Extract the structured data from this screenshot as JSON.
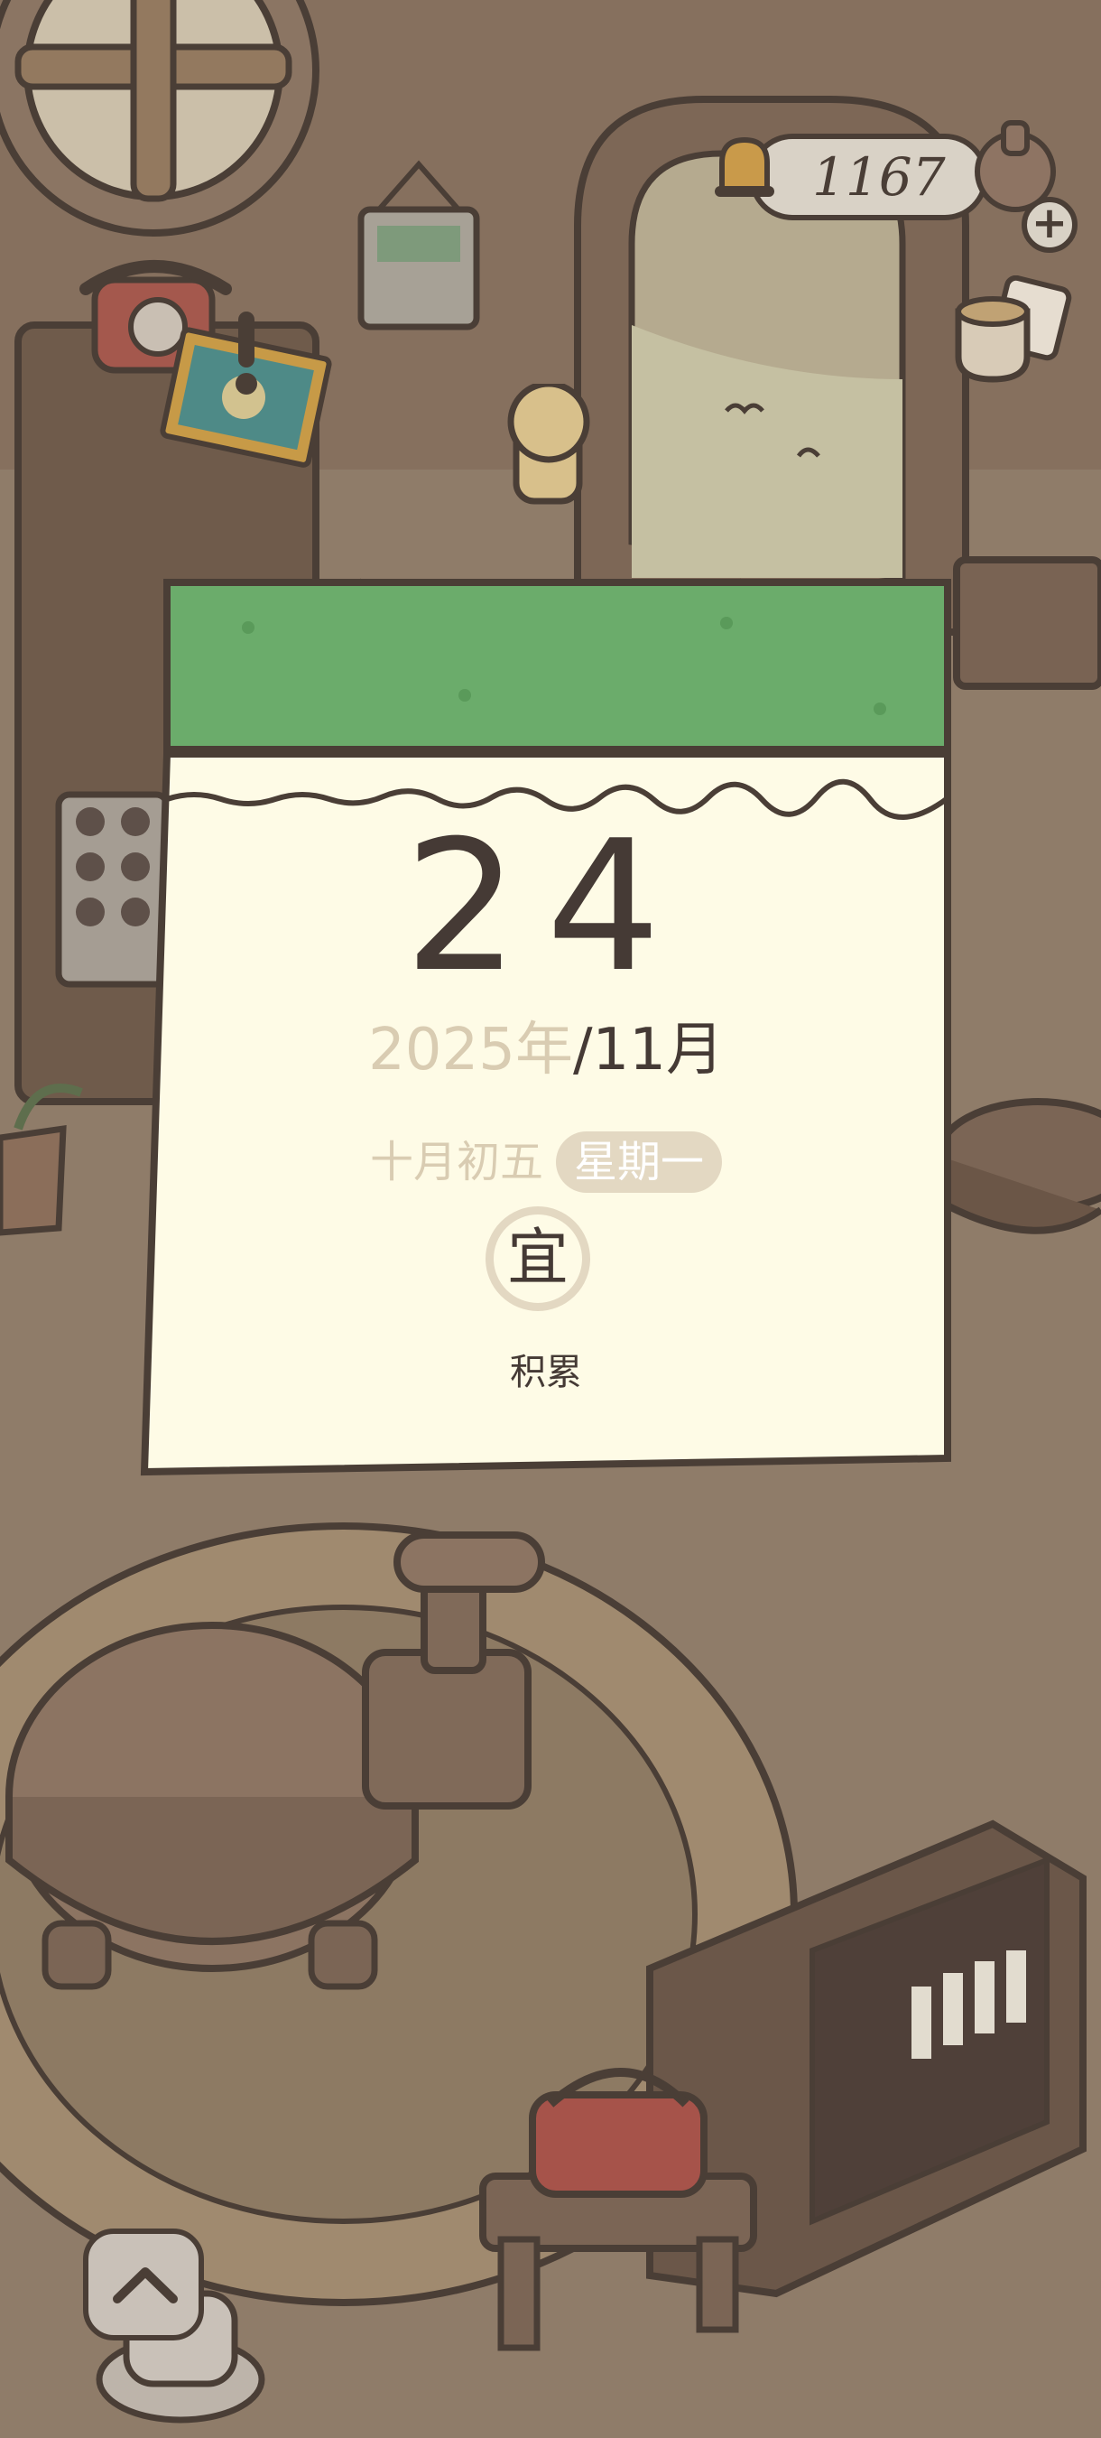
{
  "hud": {
    "clover_count": "1167",
    "plus_icon": "plus-icon",
    "plus_label": "+",
    "cup_icon": "teacup-icon",
    "expand_icon": "chevron-up-icon"
  },
  "calendar": {
    "day": "24",
    "year": "2025年",
    "month": "/11月",
    "lunar_date": "十月初五",
    "weekday": "星期一",
    "yi_label": "宜",
    "activity": "积累"
  },
  "colors": {
    "calendar_header": "#6bac6b",
    "calendar_paper": "#fefbe6",
    "outline": "#453a35",
    "muted_text": "#d9ccb2"
  }
}
